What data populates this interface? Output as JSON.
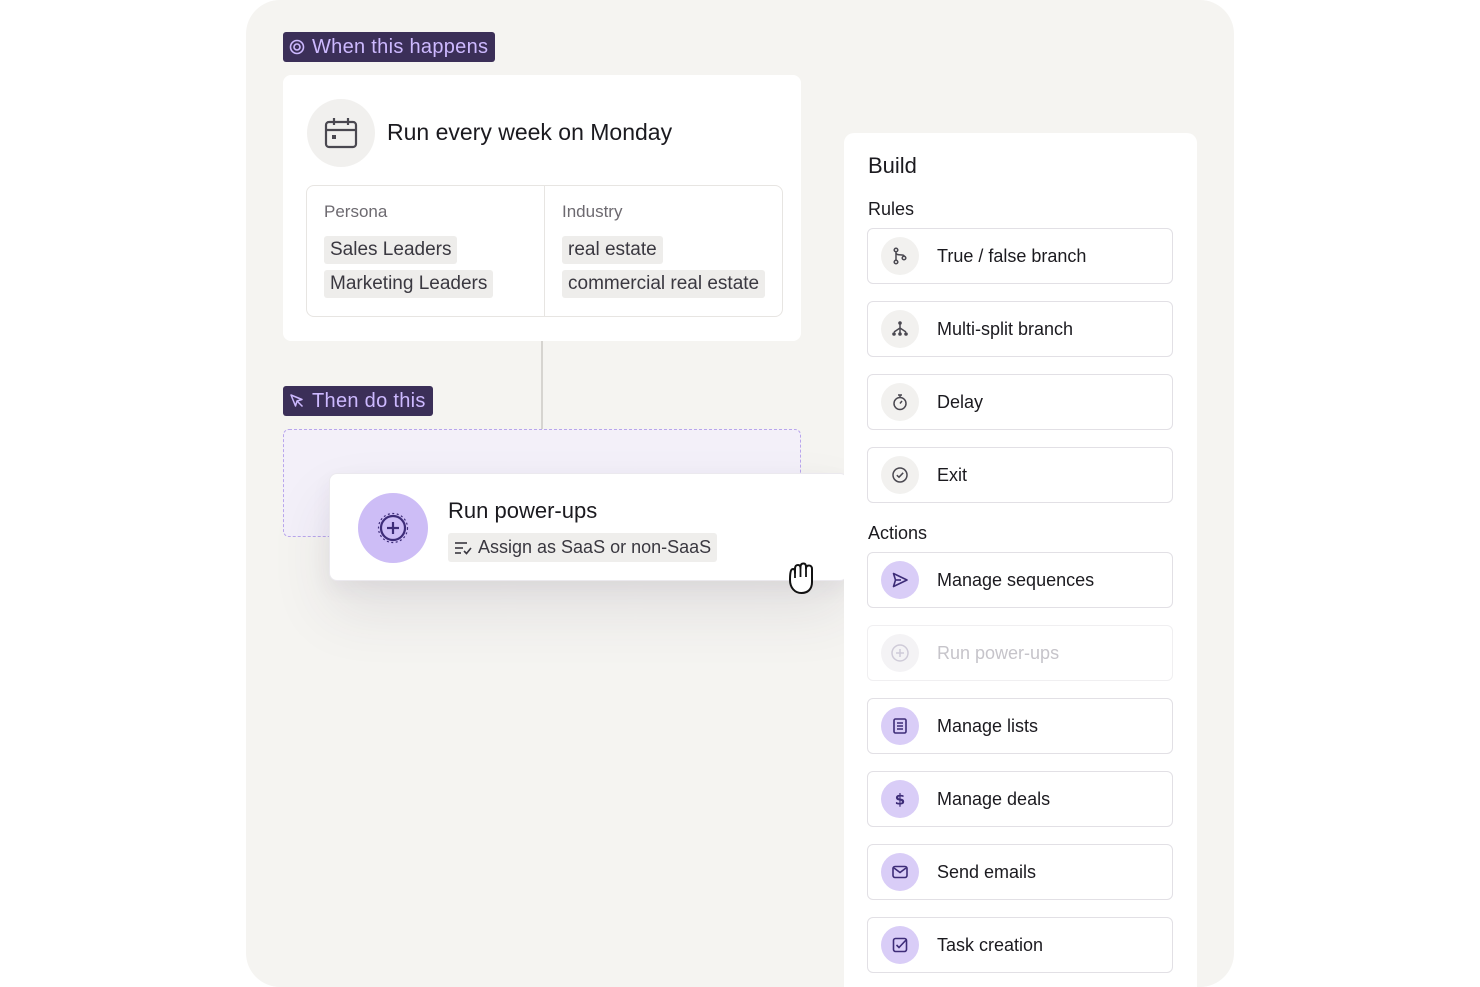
{
  "trigger": {
    "tag_label": "When this happens",
    "title": "Run every week on Monday",
    "filters": [
      {
        "heading": "Persona",
        "values": [
          "Sales Leaders",
          "Marketing Leaders"
        ]
      },
      {
        "heading": "Industry",
        "values": [
          "real estate",
          "commercial real estate"
        ]
      }
    ]
  },
  "action_section": {
    "tag_label": "Then do this"
  },
  "dragged_card": {
    "title": "Run power-ups",
    "subtitle": "Assign as SaaS or non-SaaS"
  },
  "build_panel": {
    "title": "Build",
    "rules_label": "Rules",
    "rules": [
      {
        "label": "True / false branch",
        "icon": "branch-icon"
      },
      {
        "label": "Multi-split branch",
        "icon": "multi-split-icon"
      },
      {
        "label": "Delay",
        "icon": "stopwatch-icon"
      },
      {
        "label": "Exit",
        "icon": "check-circle-icon"
      }
    ],
    "actions_label": "Actions",
    "actions": [
      {
        "label": "Manage sequences",
        "icon": "send-icon"
      },
      {
        "label": "Run power-ups",
        "icon": "power-up-icon",
        "state": "dragging"
      },
      {
        "label": "Manage lists",
        "icon": "list-icon"
      },
      {
        "label": "Manage deals",
        "icon": "dollar-icon"
      },
      {
        "label": "Send emails",
        "icon": "mail-icon"
      },
      {
        "label": "Task creation",
        "icon": "task-check-icon"
      }
    ]
  },
  "colors": {
    "tag_bg": "#3b2f58",
    "tag_text": "#cdb9ff",
    "accent_light": "#cdbdf6",
    "canvas_bg": "#f5f4f1"
  }
}
